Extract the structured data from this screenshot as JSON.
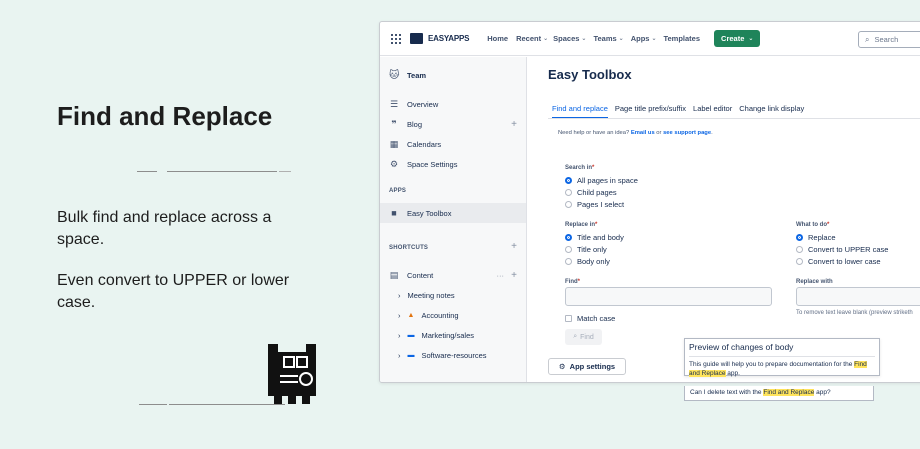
{
  "hero": {
    "title": "Find and Replace",
    "para1": "Bulk find and replace across a space.",
    "para2": "Even convert to UPPER or lower case."
  },
  "topbar": {
    "logo": "EASYAPPS",
    "nav": [
      {
        "label": "Home",
        "chevron": false
      },
      {
        "label": "Recent",
        "chevron": true
      },
      {
        "label": "Spaces",
        "chevron": true
      },
      {
        "label": "Teams",
        "chevron": true
      },
      {
        "label": "Apps",
        "chevron": true
      },
      {
        "label": "Templates",
        "chevron": false
      }
    ],
    "create_label": "Create",
    "search_placeholder": "Search"
  },
  "sidebar": {
    "space_name": "Team",
    "items": [
      {
        "label": "Overview",
        "icon": "overview-icon"
      },
      {
        "label": "Blog",
        "icon": "blog-icon"
      },
      {
        "label": "Calendars",
        "icon": "calendar-icon"
      },
      {
        "label": "Space Settings",
        "icon": "gear-icon"
      }
    ],
    "apps_header": "APPS",
    "app_item": "Easy Toolbox",
    "shortcuts_header": "SHORTCUTS",
    "content_label": "Content",
    "content_items": [
      {
        "label": "Meeting notes",
        "emoji": ""
      },
      {
        "label": "Accounting",
        "emoji": "🔥"
      },
      {
        "label": "Marketing/sales",
        "emoji": "▬"
      },
      {
        "label": "Software-resources",
        "emoji": "▬"
      }
    ]
  },
  "main": {
    "title": "Easy Toolbox",
    "tabs": [
      "Find and replace",
      "Page title prefix/suffix",
      "Label editor",
      "Change link display"
    ],
    "help_prefix": "Need help or have an idea? ",
    "help_email": "Email us",
    "help_or": " or ",
    "help_support": "see support page",
    "help_suffix": ".",
    "search_in_label": "Search in",
    "search_in_options": [
      "All pages in space",
      "Child pages",
      "Pages I select"
    ],
    "replace_in_label": "Replace in",
    "replace_in_options": [
      "Title and body",
      "Title only",
      "Body only"
    ],
    "what_to_do_label": "What to do",
    "what_to_do_options": [
      "Replace",
      "Convert to UPPER case",
      "Convert to lower case"
    ],
    "find_label": "Find",
    "replace_with_label": "Replace with",
    "match_case_label": "Match case",
    "find_button": "Find",
    "replace_hint": "To remove text leave blank (preview striketh",
    "app_settings": "App settings"
  },
  "preview": {
    "title": "Preview of changes of body",
    "line1_before": "This guide will help you to prepare documentation for the ",
    "line1_hl": "Find and Replace",
    "line1_after": " app.",
    "line2_before": "Can I delete text with the ",
    "line2_hl": "Find and Replace",
    "line2_after": " app?"
  },
  "colors": {
    "accent": "#0c66e4",
    "create": "#1f845a",
    "highlight": "#ffe45c",
    "background": "#e9f4f1"
  }
}
